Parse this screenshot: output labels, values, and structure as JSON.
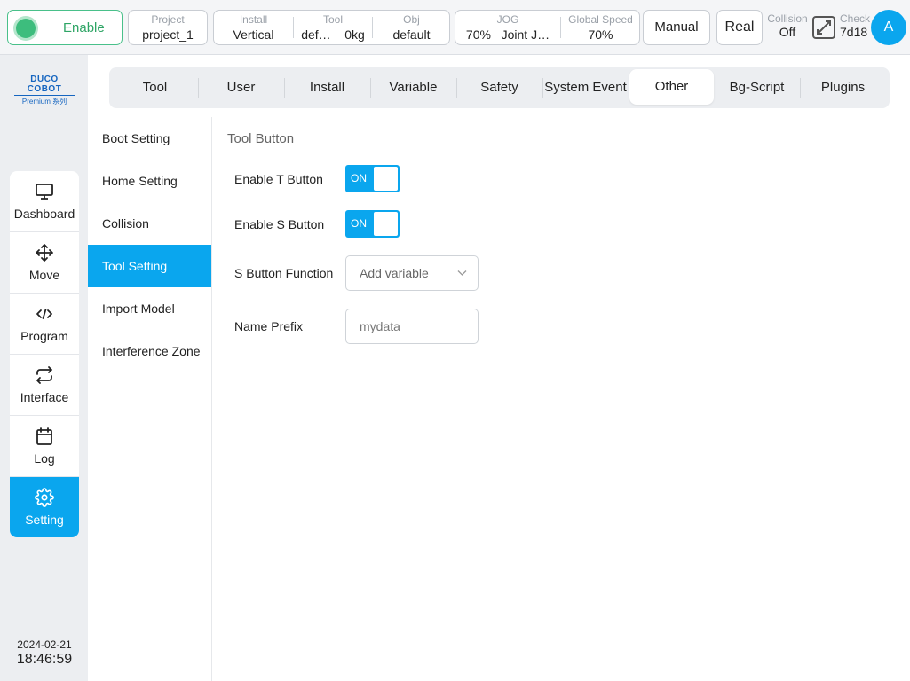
{
  "topbar": {
    "enable_label": "Enable",
    "project": {
      "label": "Project",
      "value": "project_1"
    },
    "install": {
      "label": "Install",
      "value": "Vertical"
    },
    "tool": {
      "label": "Tool",
      "name": "def…",
      "weight": "0kg"
    },
    "obj": {
      "label": "Obj",
      "value": "default"
    },
    "jog": {
      "label": "JOG",
      "percent": "70%",
      "mode": "Joint J…"
    },
    "global_speed": {
      "label": "Global Speed",
      "value": "70%"
    },
    "manual_label": "Manual",
    "real_label": "Real",
    "collision": {
      "label": "Collision",
      "value": "Off"
    },
    "check": {
      "label": "Check",
      "value": "7d18"
    },
    "avatar_letter": "A"
  },
  "logo": {
    "main": "DUCO COBOT",
    "sub": "Premium 系列"
  },
  "nav": {
    "dashboard": "Dashboard",
    "move": "Move",
    "program": "Program",
    "interface": "Interface",
    "log": "Log",
    "setting": "Setting"
  },
  "datetime": {
    "date": "2024-02-21",
    "time": "18:46:59"
  },
  "tabs": {
    "tool": "Tool",
    "user": "User",
    "install": "Install",
    "variable": "Variable",
    "safety": "Safety",
    "system_event": "System Event",
    "other": "Other",
    "bg_script": "Bg-Script",
    "plugins": "Plugins"
  },
  "submenu": {
    "boot": "Boot Setting",
    "home": "Home Setting",
    "collision": "Collision",
    "tool_setting": "Tool Setting",
    "import_model": "Import Model",
    "interference": "Interference Zone"
  },
  "content": {
    "section_title": "Tool Button",
    "enable_t": {
      "label": "Enable T Button",
      "state": "ON"
    },
    "enable_s": {
      "label": "Enable S Button",
      "state": "ON"
    },
    "s_function": {
      "label": "S Button Function",
      "value": "Add variable"
    },
    "name_prefix": {
      "label": "Name Prefix",
      "placeholder": "mydata"
    }
  },
  "colors": {
    "accent": "#0aa6ee",
    "enable_green": "#3dbd7d",
    "logo_blue": "#1565c0"
  }
}
